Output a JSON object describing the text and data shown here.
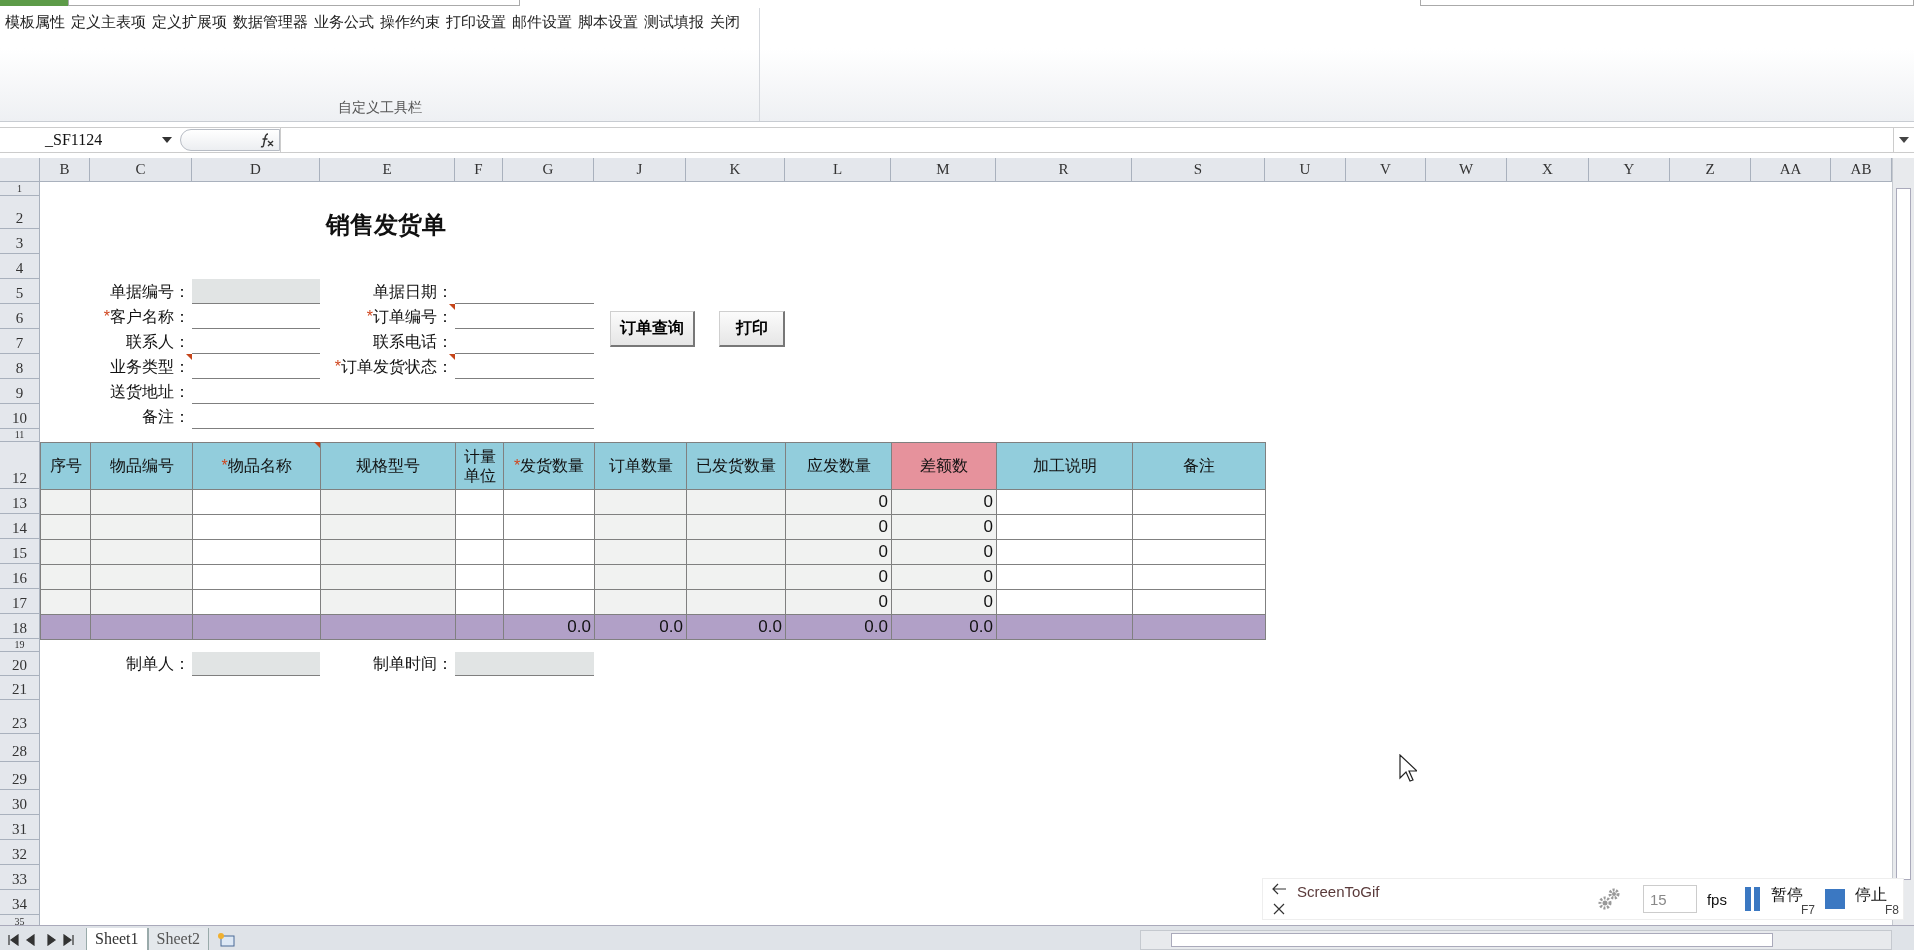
{
  "ribbon": {
    "commands": [
      "模板属性",
      "定义主表项",
      "定义扩展项",
      "数据管理器",
      "业务公式",
      "操作约束",
      "打印设置",
      "邮件设置",
      "脚本设置",
      "测试填报",
      "关闭"
    ],
    "group_label": "自定义工具栏"
  },
  "formula_bar": {
    "name_box": "_SF1124"
  },
  "sheet": {
    "column_headers": [
      "B",
      "C",
      "D",
      "E",
      "F",
      "G",
      "J",
      "K",
      "L",
      "M",
      "R",
      "S",
      "U",
      "V",
      "W",
      "X",
      "Y",
      "Z",
      "AA",
      "AB"
    ],
    "row_headers": [
      "1",
      "2",
      "3",
      "4",
      "5",
      "6",
      "7",
      "8",
      "9",
      "10",
      "11",
      "12",
      "13",
      "14",
      "15",
      "16",
      "17",
      "18",
      "19",
      "20",
      "21",
      "23",
      "28",
      "29",
      "30",
      "31",
      "32",
      "33",
      "34",
      "35"
    ]
  },
  "title": "销售发货单",
  "form": {
    "rows": [
      {
        "kind": "pair",
        "left": {
          "label": "单据编号：",
          "shaded": true,
          "comment": false
        },
        "right": {
          "label": "单据日期：",
          "shaded": false,
          "comment": false
        }
      },
      {
        "kind": "pair",
        "left": {
          "mark": "*",
          "label": "客户名称：",
          "shaded": false,
          "comment": false
        },
        "right": {
          "mark": "*",
          "label": "订单编号：",
          "shaded": false,
          "comment": true
        }
      },
      {
        "kind": "pair",
        "left": {
          "label": "联系人：",
          "shaded": false,
          "comment": false
        },
        "right": {
          "label": "联系电话：",
          "shaded": false,
          "comment": false
        }
      },
      {
        "kind": "pair",
        "left": {
          "label": "业务类型：",
          "shaded": false,
          "comment": true
        },
        "right": {
          "mark": "*",
          "label": "订单发货状态：",
          "shaded": false,
          "comment": true
        }
      },
      {
        "kind": "wide",
        "left": {
          "label": "送货地址：",
          "shaded": false,
          "comment": false
        }
      },
      {
        "kind": "wide",
        "left": {
          "label": "备注：",
          "shaded": false,
          "comment": false
        }
      }
    ]
  },
  "buttons": [
    "订单查询",
    "打印"
  ],
  "table": {
    "columns": [
      {
        "label": "序号",
        "color": "#92cddc",
        "shaded": true,
        "comment": false
      },
      {
        "label": "物品编号",
        "color": "#92cddc",
        "shaded": true,
        "comment": false
      },
      {
        "mark": "*",
        "label": "物品名称",
        "color": "#92cddc",
        "shaded": false,
        "comment": true
      },
      {
        "label": "规格型号",
        "color": "#92cddc",
        "shaded": true,
        "comment": false
      },
      {
        "label": "计量单位",
        "color": "#92cddc",
        "shaded": false,
        "comment": false
      },
      {
        "mark": "*",
        "label": "发货数量",
        "color": "#92cddc",
        "shaded": false,
        "comment": false,
        "total": "0.0"
      },
      {
        "label": "订单数量",
        "color": "#92cddc",
        "shaded": true,
        "comment": false,
        "total": "0.0"
      },
      {
        "label": "已发货数量",
        "color": "#92cddc",
        "shaded": true,
        "comment": false,
        "total": "0.0"
      },
      {
        "label": "应发数量",
        "color": "#92cddc",
        "shaded": true,
        "comment": false,
        "values": [
          "0",
          "0",
          "0",
          "0",
          "0"
        ],
        "total": "0.0"
      },
      {
        "label": "差额数",
        "color": "#e6929c",
        "shaded": true,
        "comment": false,
        "values": [
          "0",
          "0",
          "0",
          "0",
          "0"
        ],
        "total": "0.0"
      },
      {
        "label": "加工说明",
        "color": "#92cddc",
        "shaded": false,
        "comment": false
      },
      {
        "label": "备注",
        "color": "#92cddc",
        "shaded": false,
        "comment": false
      }
    ]
  },
  "footer_fields": [
    {
      "label": "制单人：",
      "shaded": true
    },
    {
      "label": "制单时间：",
      "shaded": true
    }
  ],
  "sheet_tabs": [
    {
      "label": "Sheet1",
      "selected": true
    },
    {
      "label": "Sheet2",
      "selected": false
    }
  ],
  "recorder": {
    "title": "ScreenToGif",
    "fps": "15",
    "fps_unit": "fps",
    "pause": {
      "label": "暂停",
      "key": "F7"
    },
    "stop": {
      "label": "停止",
      "key": "F8"
    }
  }
}
